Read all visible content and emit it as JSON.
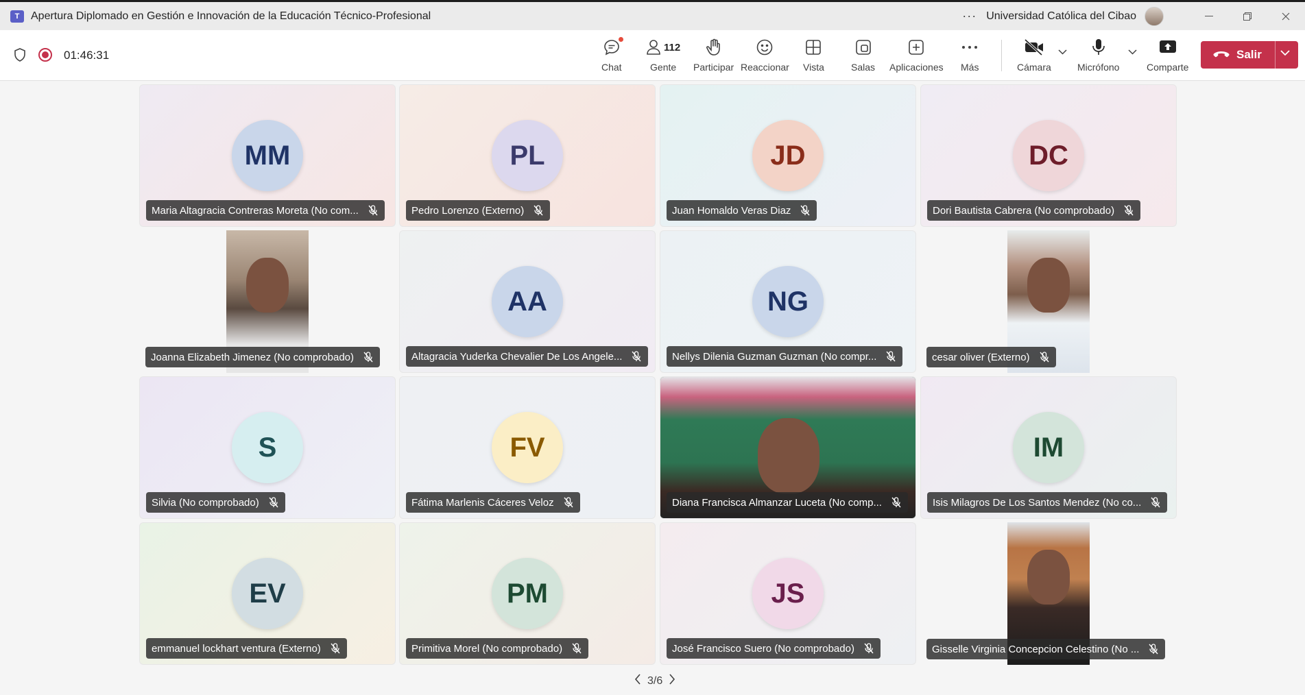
{
  "window": {
    "title": "Apertura Diplomado en Gestión e Innovación de la Educación Técnico-Profesional",
    "organization": "Universidad Católica del Cibao",
    "more_icon": "ellipsis-icon"
  },
  "toolbar": {
    "timer": "01:46:31",
    "buttons": [
      {
        "label": "Chat",
        "icon": "chat-icon"
      },
      {
        "label": "Gente",
        "icon": "people-icon",
        "count": "112"
      },
      {
        "label": "Participar",
        "icon": "raise-hand-icon"
      },
      {
        "label": "Reaccionar",
        "icon": "smiley-icon"
      },
      {
        "label": "Vista",
        "icon": "grid-view-icon"
      },
      {
        "label": "Salas",
        "icon": "breakout-rooms-icon"
      },
      {
        "label": "Aplicaciones",
        "icon": "add-apps-icon"
      },
      {
        "label": "Más",
        "icon": "more-icon"
      },
      {
        "label": "Cámara",
        "icon": "camera-off-icon"
      },
      {
        "label": "Micrófono",
        "icon": "microphone-icon"
      },
      {
        "label": "Comparte",
        "icon": "share-icon"
      }
    ],
    "leave_label": "Salir"
  },
  "participants": [
    {
      "initials": "MM",
      "name": "Maria Altagracia Contreras Moreta (No com...",
      "video": false,
      "avatar_bg": "#c9d6ea",
      "avatar_fg": "#1f3366",
      "tile_bg": "linear-gradient(135deg,#efeaf3,#f7e6e3)"
    },
    {
      "initials": "PL",
      "name": "Pedro Lorenzo (Externo)",
      "video": false,
      "avatar_bg": "#dcd8ee",
      "avatar_fg": "#3b3a6b",
      "tile_bg": "linear-gradient(135deg,#f6ece6,#f7e3df)"
    },
    {
      "initials": "JD",
      "name": "Juan Homaldo Veras Diaz",
      "video": false,
      "avatar_bg": "#f3d3c7",
      "avatar_fg": "#8a2d1a",
      "tile_bg": "linear-gradient(135deg,#e4f2f2,#eef0f6)"
    },
    {
      "initials": "DC",
      "name": "Dori Bautista Cabrera (No comprobado)",
      "video": false,
      "avatar_bg": "#efd6d9",
      "avatar_fg": "#6e1d2a",
      "tile_bg": "linear-gradient(135deg,#f0ecf4,#f6e9ec)"
    },
    {
      "initials": "",
      "name": "Joanna Elizabeth Jimenez (No comprobado)",
      "video": true,
      "video_bg": "linear-gradient(180deg,#c8b8a8 0%,#9a8573 35%,#5a4a40 55%,#e6e6e6 80%)",
      "tile_bg": "#f5f5f5"
    },
    {
      "initials": "AA",
      "name": "Altagracia Yuderka Chevalier De Los Angele...",
      "video": false,
      "avatar_bg": "#c9d6ea",
      "avatar_fg": "#1f3366",
      "tile_bg": "linear-gradient(135deg,#eef1f1,#f1ebf3)"
    },
    {
      "initials": "NG",
      "name": "Nellys Dilenia Guzman Guzman (No compr...",
      "video": false,
      "avatar_bg": "#c9d6ea",
      "avatar_fg": "#1f3366",
      "tile_bg": "linear-gradient(135deg,#ecf1f4,#eef3f6)"
    },
    {
      "initials": "",
      "name": "cesar oliver (Externo)",
      "video": true,
      "video_bg": "linear-gradient(180deg,#e8ecec 0%,#b39180 25%,#7d5e4c 45%,#eef2f5 65%,#dde4ec 100%)",
      "tile_bg": "#f5f5f5"
    },
    {
      "initials": "S",
      "name": "Silvia (No comprobado)",
      "video": false,
      "avatar_bg": "#d6eef0",
      "avatar_fg": "#1f5256",
      "tile_bg": "linear-gradient(135deg,#ece6f3,#eef0f6)"
    },
    {
      "initials": "FV",
      "name": "Fátima Marlenis Cáceres Veloz",
      "video": false,
      "avatar_bg": "#fbeec6",
      "avatar_fg": "#8a5a00",
      "tile_bg": "linear-gradient(135deg,#eef0f3,#edf0f4)"
    },
    {
      "initials": "",
      "name": "Diana Francisca Almanzar Luceta (No comp...",
      "video": true,
      "video_bg": "linear-gradient(180deg,#e4e2e6 0%,#c9637f 14%,#2f7a56 30%,#2d7452 60%,#3a2a24 80%,#222 100%)",
      "tile_bg": "#2d7452",
      "full": true
    },
    {
      "initials": "IM",
      "name": "Isis Milagros De Los Santos Mendez (No co...",
      "video": false,
      "avatar_bg": "#d3e4da",
      "avatar_fg": "#1d4a32",
      "tile_bg": "linear-gradient(135deg,#f1e9f3,#eaf1ef)"
    },
    {
      "initials": "EV",
      "name": "emmanuel lockhart ventura (Externo)",
      "video": false,
      "avatar_bg": "#d2dde2",
      "avatar_fg": "#1f3d48",
      "tile_bg": "linear-gradient(135deg,#e9f3e6,#f7efe3)"
    },
    {
      "initials": "PM",
      "name": "Primitiva Morel (No comprobado)",
      "video": false,
      "avatar_bg": "#d3e4da",
      "avatar_fg": "#1d4a32",
      "tile_bg": "linear-gradient(135deg,#eef3ea,#f4ebe6)"
    },
    {
      "initials": "JS",
      "name": "José Francisco Suero (No comprobado)",
      "video": false,
      "avatar_bg": "#f1d9e8",
      "avatar_fg": "#6a1f4c",
      "tile_bg": "linear-gradient(135deg,#f4ecef,#eef0f3)"
    },
    {
      "initials": "",
      "name": "Gisselle Virginia Concepcion Celestino (No ...",
      "video": true,
      "video_bg": "linear-gradient(180deg,#dfe3e8 0%,#b87445 18%,#c08150 40%,#3a2a26 60%,#1c1c1c 100%)",
      "tile_bg": "#f5f5f5"
    }
  ],
  "pager": {
    "label": "3/6"
  }
}
